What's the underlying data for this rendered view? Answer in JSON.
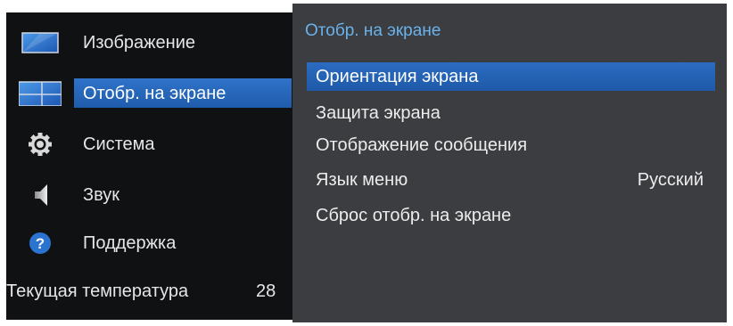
{
  "left_menu": {
    "items": [
      {
        "label": "Изображение",
        "icon": "picture-icon"
      },
      {
        "label": "Отобр. на экране",
        "icon": "onscreen-display-icon",
        "selected": true
      },
      {
        "label": "Система",
        "icon": "gear-icon"
      },
      {
        "label": "Звук",
        "icon": "speaker-icon"
      },
      {
        "label": "Поддержка",
        "icon": "help-icon"
      }
    ],
    "temperature_label": "Текущая температура",
    "temperature_value": "28"
  },
  "submenu": {
    "title": "Отобр. на экране",
    "items": [
      {
        "label": "Ориентация экрана",
        "value": "",
        "selected": true
      },
      {
        "label": "Защита экрана",
        "value": ""
      },
      {
        "label": "Отображение сообщения",
        "value": ""
      },
      {
        "label": "Язык меню",
        "value": "Русский"
      },
      {
        "label": "Сброс отобр. на экране",
        "value": ""
      }
    ]
  },
  "colors": {
    "left_panel_bg": "#101113",
    "right_panel_bg": "#3c3d40",
    "selection_blue": "#2a6cc3",
    "title_blue": "#6ab2ec"
  }
}
